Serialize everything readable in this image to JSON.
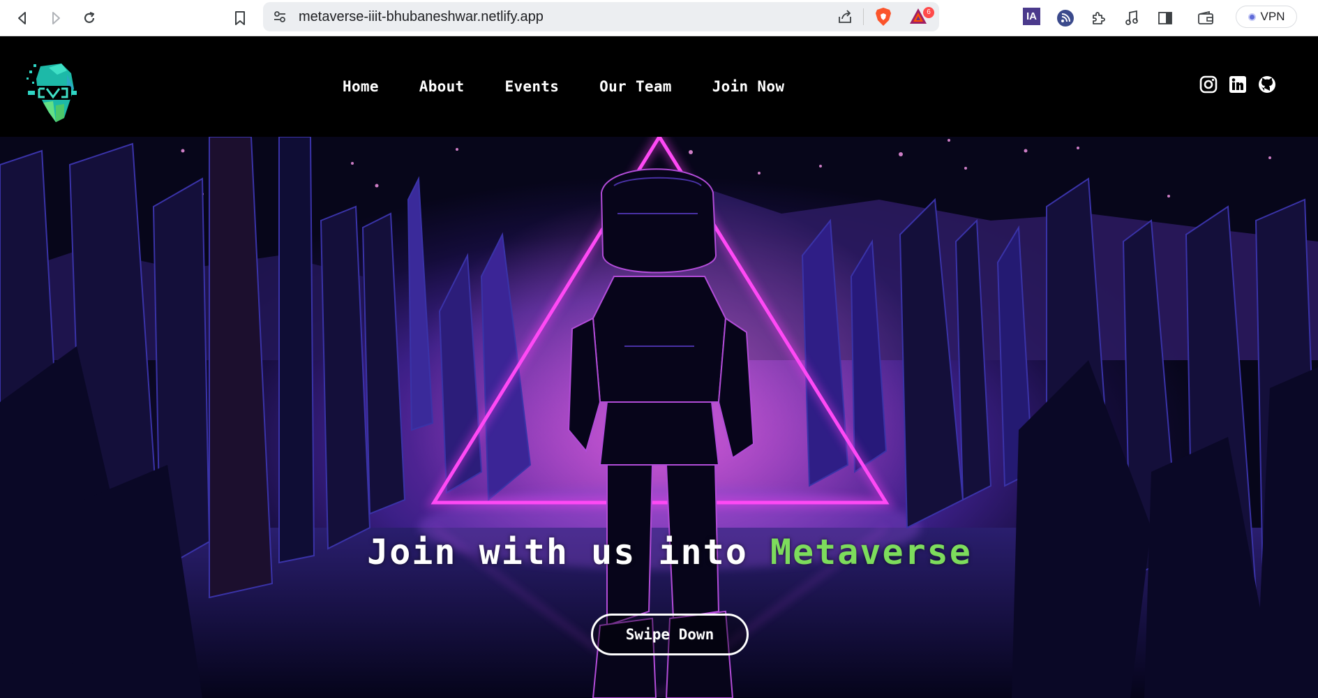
{
  "browser": {
    "url": "metaverse-iiit-bhubaneshwar.netlify.app",
    "extension_badge_count": "6",
    "ia_extension_label": "IA",
    "vpn_label": "VPN",
    "icons": [
      "back-icon",
      "forward-icon",
      "reload-icon",
      "bookmark-icon",
      "site-settings-icon",
      "share-icon",
      "brave-shields-icon",
      "brave-rewards-icon",
      "ia-extension-icon",
      "rss-icon",
      "extensions-icon",
      "media-icon",
      "sidebar-icon",
      "wallet-icon",
      "vpn-icon"
    ]
  },
  "site": {
    "nav": {
      "items": [
        {
          "label": "Home"
        },
        {
          "label": "About"
        },
        {
          "label": "Events"
        },
        {
          "label": "Our Team"
        },
        {
          "label": "Join Now"
        }
      ]
    },
    "social": [
      "instagram-icon",
      "linkedin-icon",
      "github-icon"
    ],
    "hero": {
      "title_prefix": "Join with us into ",
      "title_highlight": "Metaverse",
      "button_label": "Swipe Down"
    }
  },
  "colors": {
    "highlight": "#7ddc5c",
    "neon_triangle": "#ff3df7",
    "nav_bg": "#000000",
    "logo_accent": "#2fd6c5"
  }
}
